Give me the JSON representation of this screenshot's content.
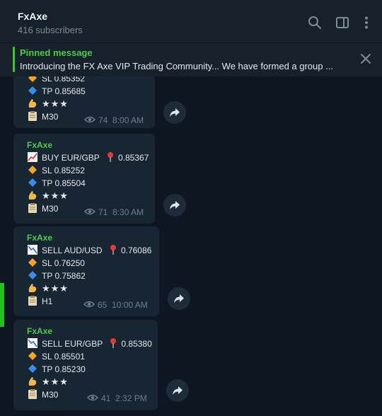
{
  "header": {
    "title": "FxAxe",
    "subtitle": "416 subscribers",
    "icons": [
      "search-icon",
      "sidebar-toggle-icon",
      "more-vertical-icon"
    ]
  },
  "pinned": {
    "label": "Pinned message",
    "text": "Introducing the FX Axe VIP Trading Community...  We have formed a group ..."
  },
  "messages": [
    {
      "author": "",
      "signal": "",
      "sl": "SL 0.85352",
      "tp": "TP 0.85685",
      "stars": "★★★",
      "timeframe": "M30",
      "views": "74",
      "time": "8:00 AM"
    },
    {
      "author": "FxAxe",
      "signal": "BUY EUR/GBP",
      "entry": "0.85367",
      "sl": "SL 0.85252",
      "tp": "TP 0.85504",
      "stars": "★★★",
      "timeframe": "M30",
      "views": "71",
      "time": "8:30 AM"
    },
    {
      "author": "FxAxe",
      "signal": "SELL AUD/USD",
      "entry": "0.76086",
      "sl": "SL 0.76250",
      "tp": "TP 0.75862",
      "stars": "★★★",
      "timeframe": "H1",
      "views": "65",
      "time": "10:00 AM"
    },
    {
      "author": "FxAxe",
      "signal": "SELL EUR/GBP",
      "entry": "0.85380",
      "sl": "SL 0.85501",
      "tp": "TP 0.85230",
      "stars": "★★★",
      "timeframe": "M30",
      "views": "41",
      "time": "2:32 PM"
    }
  ],
  "colors": {
    "background": "#0e1621",
    "bubble": "#182533",
    "author": "#4fca4a",
    "sl_diamond": "#f5a623",
    "tp_diamond": "#3a8ee6"
  }
}
